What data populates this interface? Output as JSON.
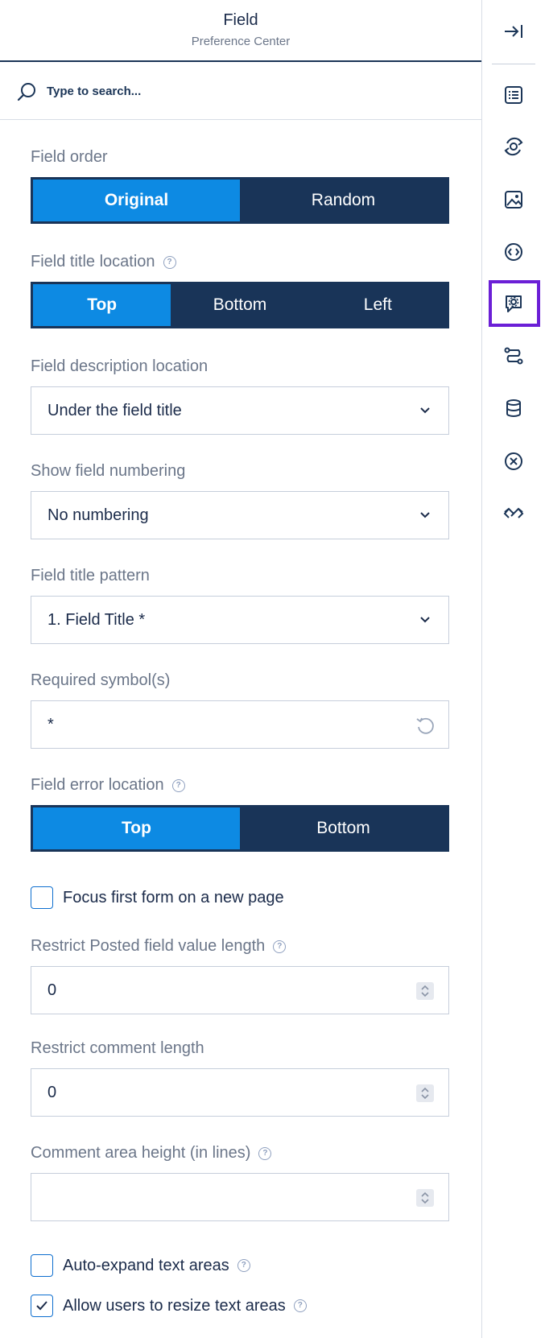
{
  "header": {
    "title": "Field",
    "subtitle": "Preference Center"
  },
  "search": {
    "placeholder": "Type to search..."
  },
  "field_order": {
    "label": "Field order",
    "options": [
      "Original",
      "Random"
    ],
    "selected": "Original"
  },
  "title_location": {
    "label": "Field title location",
    "options": [
      "Top",
      "Bottom",
      "Left"
    ],
    "selected": "Top"
  },
  "description_location": {
    "label": "Field description location",
    "value": "Under the field title"
  },
  "numbering": {
    "label": "Show field numbering",
    "value": "No numbering"
  },
  "title_pattern": {
    "label": "Field title pattern",
    "value": "1. Field Title *"
  },
  "required_symbol": {
    "label": "Required symbol(s)",
    "value": "*"
  },
  "error_location": {
    "label": "Field error location",
    "options": [
      "Top",
      "Bottom"
    ],
    "selected": "Top"
  },
  "focus_first": {
    "label": "Focus first form on a new page",
    "checked": false
  },
  "restrict_posted": {
    "label": "Restrict Posted field value length",
    "value": "0"
  },
  "restrict_comment": {
    "label": "Restrict comment length",
    "value": "0"
  },
  "comment_height": {
    "label": "Comment area height (in lines)",
    "value": ""
  },
  "auto_expand": {
    "label": "Auto-expand text areas",
    "checked": false
  },
  "allow_resize": {
    "label": "Allow users to resize text areas",
    "checked": true
  },
  "help_glyph": "?",
  "colors": {
    "accent": "#0d8ae3",
    "navy": "#193458",
    "selection": "#6b1fd6"
  },
  "rail_icons": [
    "collapse-icon",
    "list-icon",
    "theme-icon",
    "image-icon",
    "code-icon",
    "settings-chat-icon",
    "path-icon",
    "database-icon",
    "close-circle-icon",
    "handshake-icon"
  ]
}
